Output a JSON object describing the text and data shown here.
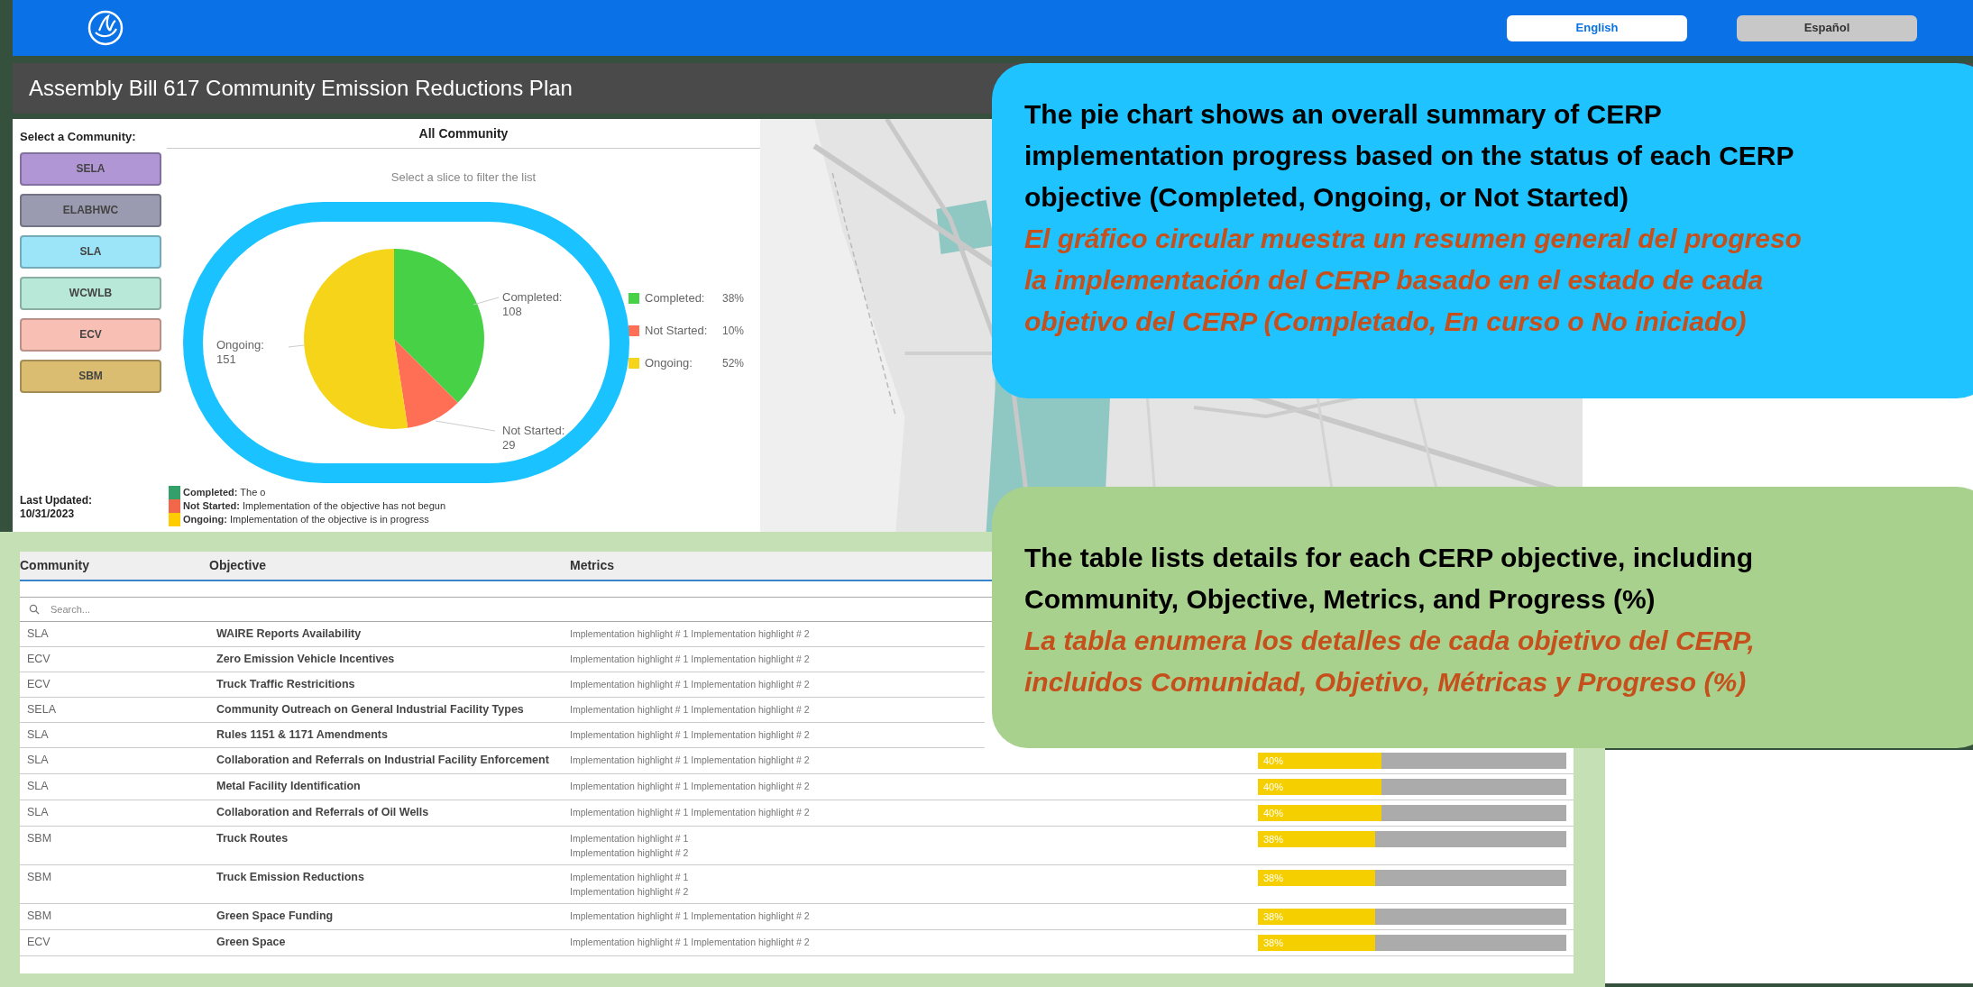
{
  "header": {
    "languages": [
      {
        "label": "English",
        "selected": true
      },
      {
        "label": "Español",
        "selected": false
      }
    ]
  },
  "title": "Assembly Bill 617 Community Emission Reductions Plan",
  "sidebar": {
    "heading": "Select a Community:",
    "communities": [
      {
        "label": "SELA",
        "color": "#b196d6"
      },
      {
        "label": "ELABHWC",
        "color": "#9a9bb0"
      },
      {
        "label": "SLA",
        "color": "#9ce4f7"
      },
      {
        "label": "WCWLB",
        "color": "#b8e8d8"
      },
      {
        "label": "ECV",
        "color": "#f8c0b4"
      },
      {
        "label": "SBM",
        "color": "#dbbd72"
      }
    ],
    "last_updated_label": "Last Updated:",
    "last_updated": "10/31/2023"
  },
  "pie_panel": {
    "title": "All Community",
    "hint": "Select a slice to filter the list",
    "slice_label_separator": ":",
    "chart_data": {
      "type": "pie",
      "categories": [
        "Completed",
        "Not Started",
        "Ongoing"
      ],
      "series": [
        {
          "values": [
            108,
            29,
            151
          ]
        }
      ],
      "data_labels": true
    },
    "legend": [
      {
        "label": "Completed:",
        "percent": "38%",
        "color": "#47d147"
      },
      {
        "label": "Not Started:",
        "percent": "10%",
        "color": "#ff6f55"
      },
      {
        "label": "Ongoing:",
        "percent": "52%",
        "color": "#f5d41a"
      }
    ],
    "status_key": [
      {
        "label": "Completed:",
        "text": "The o",
        "color": "#33a06a"
      },
      {
        "label": "Not Started:",
        "text": "Implementation of the objective has not begun",
        "color": "#f2664a"
      },
      {
        "label": "Ongoing:",
        "text": "Implementation of the objective is in progress",
        "color": "#ffcc00"
      }
    ]
  },
  "table": {
    "columns": [
      "Community",
      "Objective",
      "Metrics"
    ],
    "search": {
      "placeholder": "Search..."
    },
    "rows": [
      {
        "community": "SLA",
        "objective": "WAIRE Reports Availability",
        "metrics": [
          "Implementation highlight # 1 Implementation highlight # 2"
        ]
      },
      {
        "community": "ECV",
        "objective": "Zero Emission Vehicle Incentives",
        "metrics": [
          "Implementation highlight # 1 Implementation highlight # 2"
        ]
      },
      {
        "community": "ECV",
        "objective": "Truck Traffic Restricitions",
        "metrics": [
          "Implementation highlight # 1 Implementation highlight # 2"
        ]
      },
      {
        "community": "SELA",
        "objective": "Community Outreach on General Industrial Facility Types",
        "metrics": [
          "Implementation highlight # 1 Implementation highlight # 2"
        ]
      },
      {
        "community": "SLA",
        "objective": "Rules 1151 & 1171 Amendments",
        "metrics": [
          "Implementation highlight # 1 Implementation highlight # 2"
        ]
      },
      {
        "community": "SLA",
        "objective": "Collaboration and Referrals on Industrial Facility Enforcement",
        "metrics": [
          "Implementation highlight # 1 Implementation highlight # 2"
        ],
        "progress": {
          "text": "40%",
          "level": 0.4
        }
      },
      {
        "community": "SLA",
        "objective": "Metal Facility Identification",
        "metrics": [
          "Implementation highlight # 1 Implementation highlight # 2"
        ],
        "progress": {
          "text": "40%",
          "level": 0.4
        }
      },
      {
        "community": "SLA",
        "objective": "Collaboration and Referrals of Oil Wells",
        "metrics": [
          "Implementation highlight # 1 Implementation highlight # 2"
        ],
        "progress": {
          "text": "40%",
          "level": 0.4
        }
      },
      {
        "community": "SBM",
        "objective": "Truck Routes",
        "metrics": [
          "Implementation highlight # 1",
          "Implementation highlight # 2"
        ],
        "progress": {
          "text": "38%",
          "level": 0.38
        }
      },
      {
        "community": "SBM",
        "objective": "Truck Emission Reductions",
        "metrics": [
          "Implementation highlight # 1",
          "Implementation highlight # 2"
        ],
        "progress": {
          "text": "38%",
          "level": 0.38
        }
      },
      {
        "community": "SBM",
        "objective": "Green Space Funding",
        "metrics": [
          "Implementation highlight # 1 Implementation highlight # 2"
        ],
        "progress": {
          "text": "38%",
          "level": 0.38
        }
      },
      {
        "community": "ECV",
        "objective": "Green Space",
        "metrics": [
          "Implementation highlight # 1 Implementation highlight # 2"
        ],
        "progress": {
          "text": "38%",
          "level": 0.38
        }
      }
    ]
  },
  "callouts": [
    {
      "color": "#1ec3ff",
      "paragraphs": [
        {
          "kind": "english",
          "lines": [
            "The pie chart shows an overall summary of CERP",
            "implementation progress based on the status of each CERP",
            "objective (Completed, Ongoing, or Not Started)"
          ]
        },
        {
          "kind": "spanish",
          "lines": [
            "El gráfico circular muestra un resumen general del progreso",
            "la implementación del CERP basado en el estado de cada",
            "objetivo del CERP (Completado, En curso o No iniciado)"
          ]
        }
      ]
    },
    {
      "color": "#a9d18e",
      "paragraphs": [
        {
          "kind": "english",
          "lines": [
            "The table lists details for each CERP objective, including",
            "Community, Objective, Metrics, and Progress (%)"
          ]
        },
        {
          "kind": "spanish",
          "lines": [
            "La tabla enumera los detalles de cada objetivo del CERP,",
            "incluidos Comunidad, Objetivo, Métricas y Progreso (%)"
          ]
        }
      ]
    }
  ]
}
